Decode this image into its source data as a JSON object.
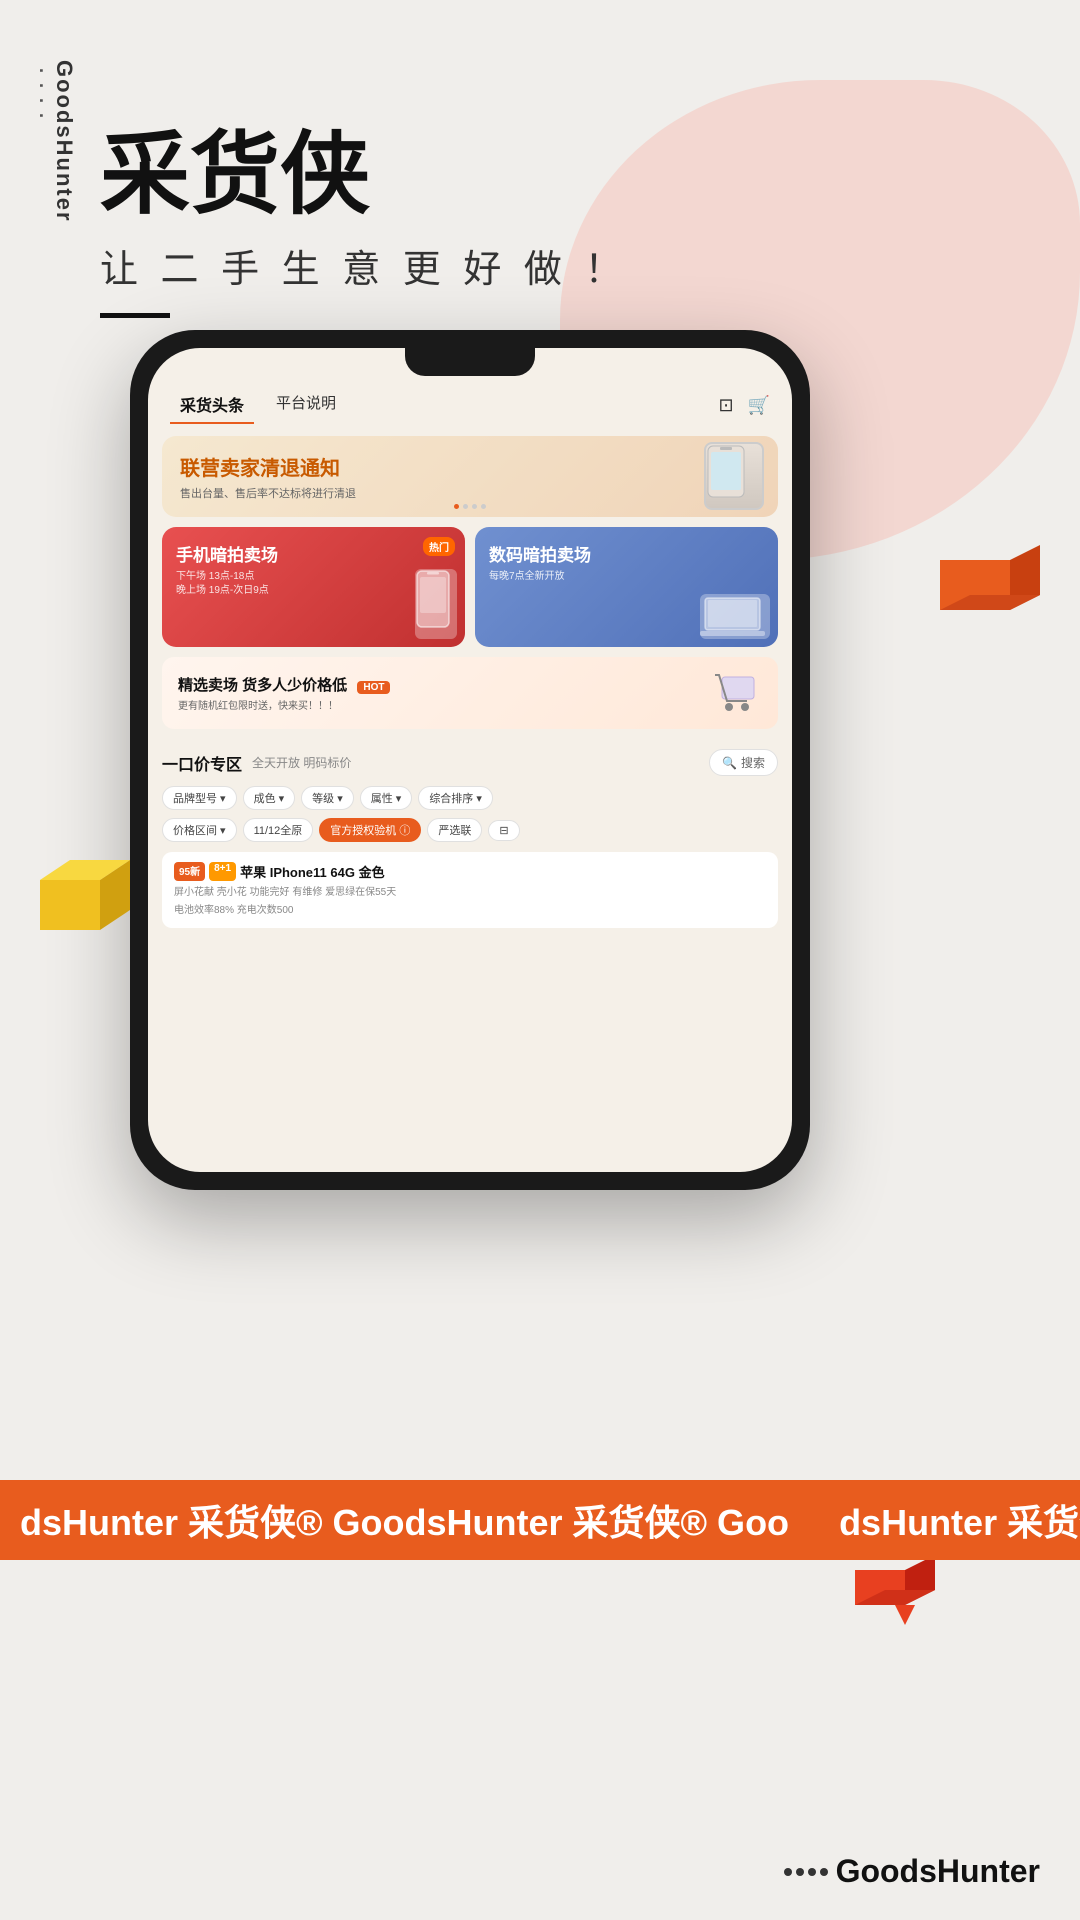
{
  "brand": {
    "name": "GoodsHunter",
    "vertical_label": "GoodsHunter",
    "dots": "· · · ·"
  },
  "headline": {
    "title": "采货侠",
    "subtitle": "让 二 手 生 意 更 好 做 ！"
  },
  "phone": {
    "topbar": {
      "tab1": "采货头条",
      "tab2": "平台说明",
      "icon1": "⊡",
      "icon2": "🛒"
    },
    "banner": {
      "title": "联营卖家清退通知",
      "desc": "售出台量、售后率不达标将进行清退"
    },
    "category": {
      "card1": {
        "title": "手机暗拍卖场",
        "subtitle": "下午场 13点-18点\n晚上场 19点-次日9点",
        "badge": "热门"
      },
      "card2": {
        "title": "数码暗拍卖场",
        "subtitle": "每晚7点全新开放"
      }
    },
    "select_market": {
      "title": "精选卖场 货多人少价格低",
      "badge": "HOT",
      "desc": "更有随机红包限时送，快来买！！！"
    },
    "fixed_price": {
      "title": "一口价专区",
      "subtitle": "全天开放 明码标价",
      "search_placeholder": "搜索"
    },
    "filters1": [
      "品牌型号▾",
      "成色▾",
      "等级▾",
      "属性▾",
      "综合排序▾"
    ],
    "filters2": [
      "价格区间▾",
      "11/12全原",
      "官方授权验机",
      "严选联",
      "⊟"
    ],
    "product": {
      "tag1": "95新",
      "tag2": "8+1",
      "name": "苹果 IPhone11 64G 金色",
      "desc1": "屏小花献  壳小花  功能完好  有维修  爱思绿在保55天",
      "desc2": "电池效率88%  充电次数500"
    }
  },
  "strip": {
    "text": "dsHunter 采货侠®   GoodsHunter 采货侠®   Goo"
  },
  "footer": {
    "dots": "· · · ·",
    "brand": "GoodsHunter"
  }
}
